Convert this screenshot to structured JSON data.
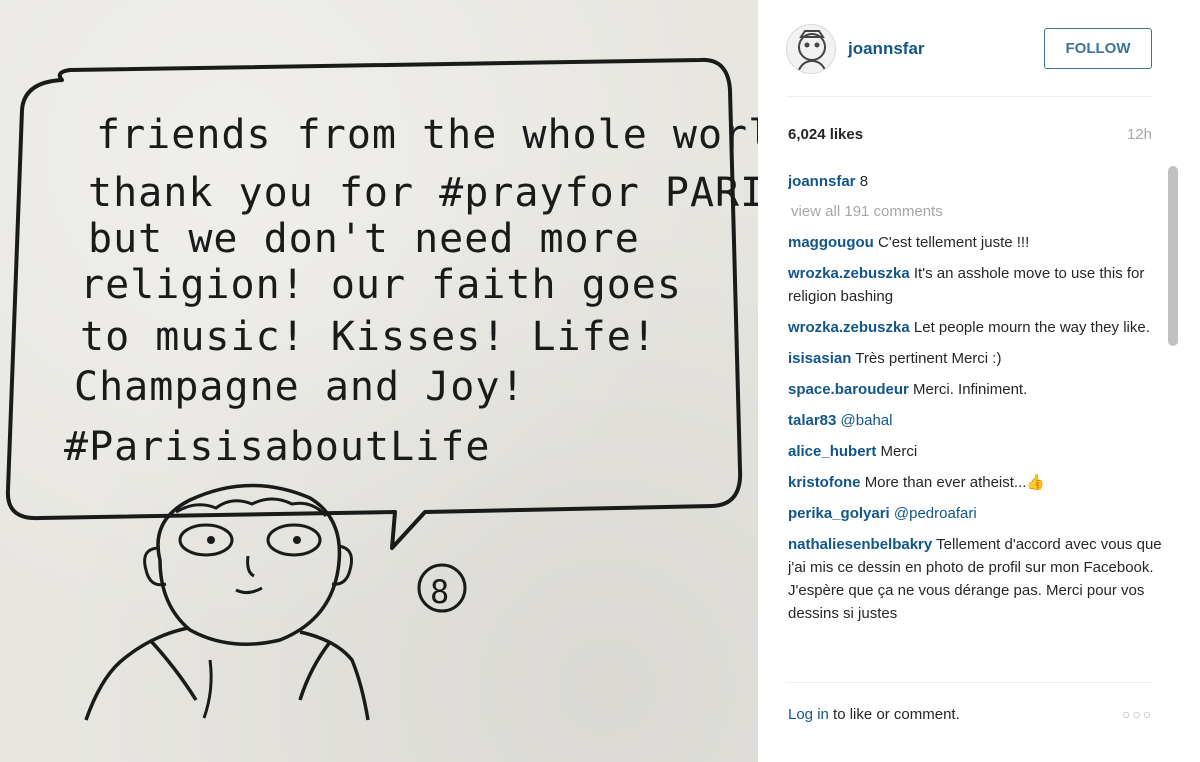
{
  "post": {
    "image_text": {
      "lines": [
        "friends from the whole world,",
        "thank you for #prayfor PARIS,",
        "but we don't need more",
        "religion! our faith goes",
        "to music! Kisses! Life!",
        "Champagne and Joy!",
        "#ParisisaboutLife"
      ],
      "signature": "8"
    }
  },
  "header": {
    "username": "joannsfar",
    "follow_label": "FOLLOW",
    "avatar_icon": "avatar-icon"
  },
  "stats": {
    "likes": "6,024 likes",
    "time": "12h"
  },
  "caption": {
    "user": "joannsfar",
    "text": "8"
  },
  "view_all": "view all 191 comments",
  "comments": [
    {
      "user": "maggougou",
      "text": "C'est tellement juste !!!"
    },
    {
      "user": "wrozka.zebuszka",
      "text": "It's an asshole move to use this for religion bashing"
    },
    {
      "user": "wrozka.zebuszka",
      "text": "Let people mourn the way they like."
    },
    {
      "user": "isisasian",
      "text": "Très pertinent Merci :)"
    },
    {
      "user": "space.baroudeur",
      "text": "Merci. Infiniment."
    },
    {
      "user": "talar83",
      "text": "@bahal"
    },
    {
      "user": "alice_hubert",
      "text": "Merci"
    },
    {
      "user": "kristofone",
      "text": "More than ever atheist...👍"
    },
    {
      "user": "perika_golyari",
      "text": "@pedroafari"
    },
    {
      "user": "nathaliesenbelbakry",
      "text": "Tellement d'accord avec vous que j'ai mis ce dessin en photo de profil sur mon Facebook. J'espère que ça ne vous dérange pas. Merci pour vos dessins si justes"
    }
  ],
  "footer": {
    "login_link": "Log in",
    "login_rest": " to like or comment.",
    "more_label": "○○○"
  },
  "colors": {
    "link": "#125688",
    "follow_border": "#3f729b",
    "muted": "#a5a7aa"
  }
}
